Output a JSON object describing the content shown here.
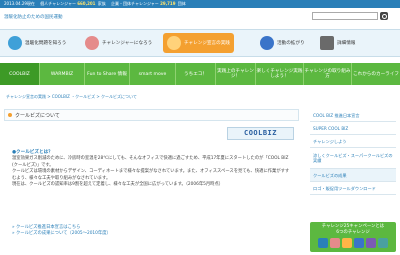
{
  "topbar": {
    "date": "2013.04.29現在",
    "personal_label": "個人チャレンジャー",
    "personal_count": "660,201",
    "personal_unit": "家族",
    "corp_label": "企業・団体チャレンジャー",
    "corp_count": "29,719",
    "corp_unit": "団体"
  },
  "header": {
    "site_title": "温暖化防止のための国民運動",
    "search_placeholder": ""
  },
  "bignav": [
    {
      "label": "温暖化問題を知ろう",
      "color": "#3fa0d8"
    },
    {
      "label": "チャレンジャーになろう",
      "color": "#e58b8b"
    },
    {
      "label": "チャレンジ宣言の実践",
      "color": "#ffb547"
    },
    {
      "label": "活動の拡がり",
      "color": "#3a74c9"
    },
    {
      "label": "詳細情報",
      "color": "#6a6a6a"
    }
  ],
  "tabs": [
    "COOLBIZ",
    "WARMBIZ",
    "Fun to Share 情報",
    "smart move",
    "うちエコ！",
    "実践上のチャレンジ！",
    "楽しくチャレンジ実践しよう！",
    "チャレンジの取り組み方",
    "これからのカーライフ"
  ],
  "breadcrumb": "チャレンジ宣言の実践 > COOLBIZ ・クールビズ > クールビズについて",
  "page_title": "クールビズについて",
  "logo_text": "COOLBIZ",
  "section_heading": "●クールビズとは？",
  "body_lines": [
    "温室効果ガス削減のために、冷房時の室温を28℃にしても、そんなオフィスで快適に過ごすため、平成17年夏にスタートしたのが「COOL BIZ (クールビズ)」です。",
    "クールビズは環境の素材からデザイン、コーディネートまで様々な提案がなされています。また、オフィススペースを見ても、快適に作業がすすむよう、様々な工夫や取り組みがなされています。",
    "現在は、クールビズの認知率は9割を超えて定着し、様々な工夫が全国に広がっています。（2006年5月時点）"
  ],
  "links": [
    "» クールビズ推進日本宣言はこちら",
    "» クールビズの成果について（2005〜2010年度）"
  ],
  "sidebar": [
    "COOL BIZ 推進日本宣言",
    "SUPER COOL BIZ",
    "チャレンジしよう",
    "涼しくクールビズ・スーパークールビズの実績",
    "クールビズの成果",
    "ロゴ・販促用ツールダウンロード"
  ],
  "banner": {
    "line1": "チャレンジ25キャンペーンとは",
    "line2": "6つのチャレンジ"
  }
}
